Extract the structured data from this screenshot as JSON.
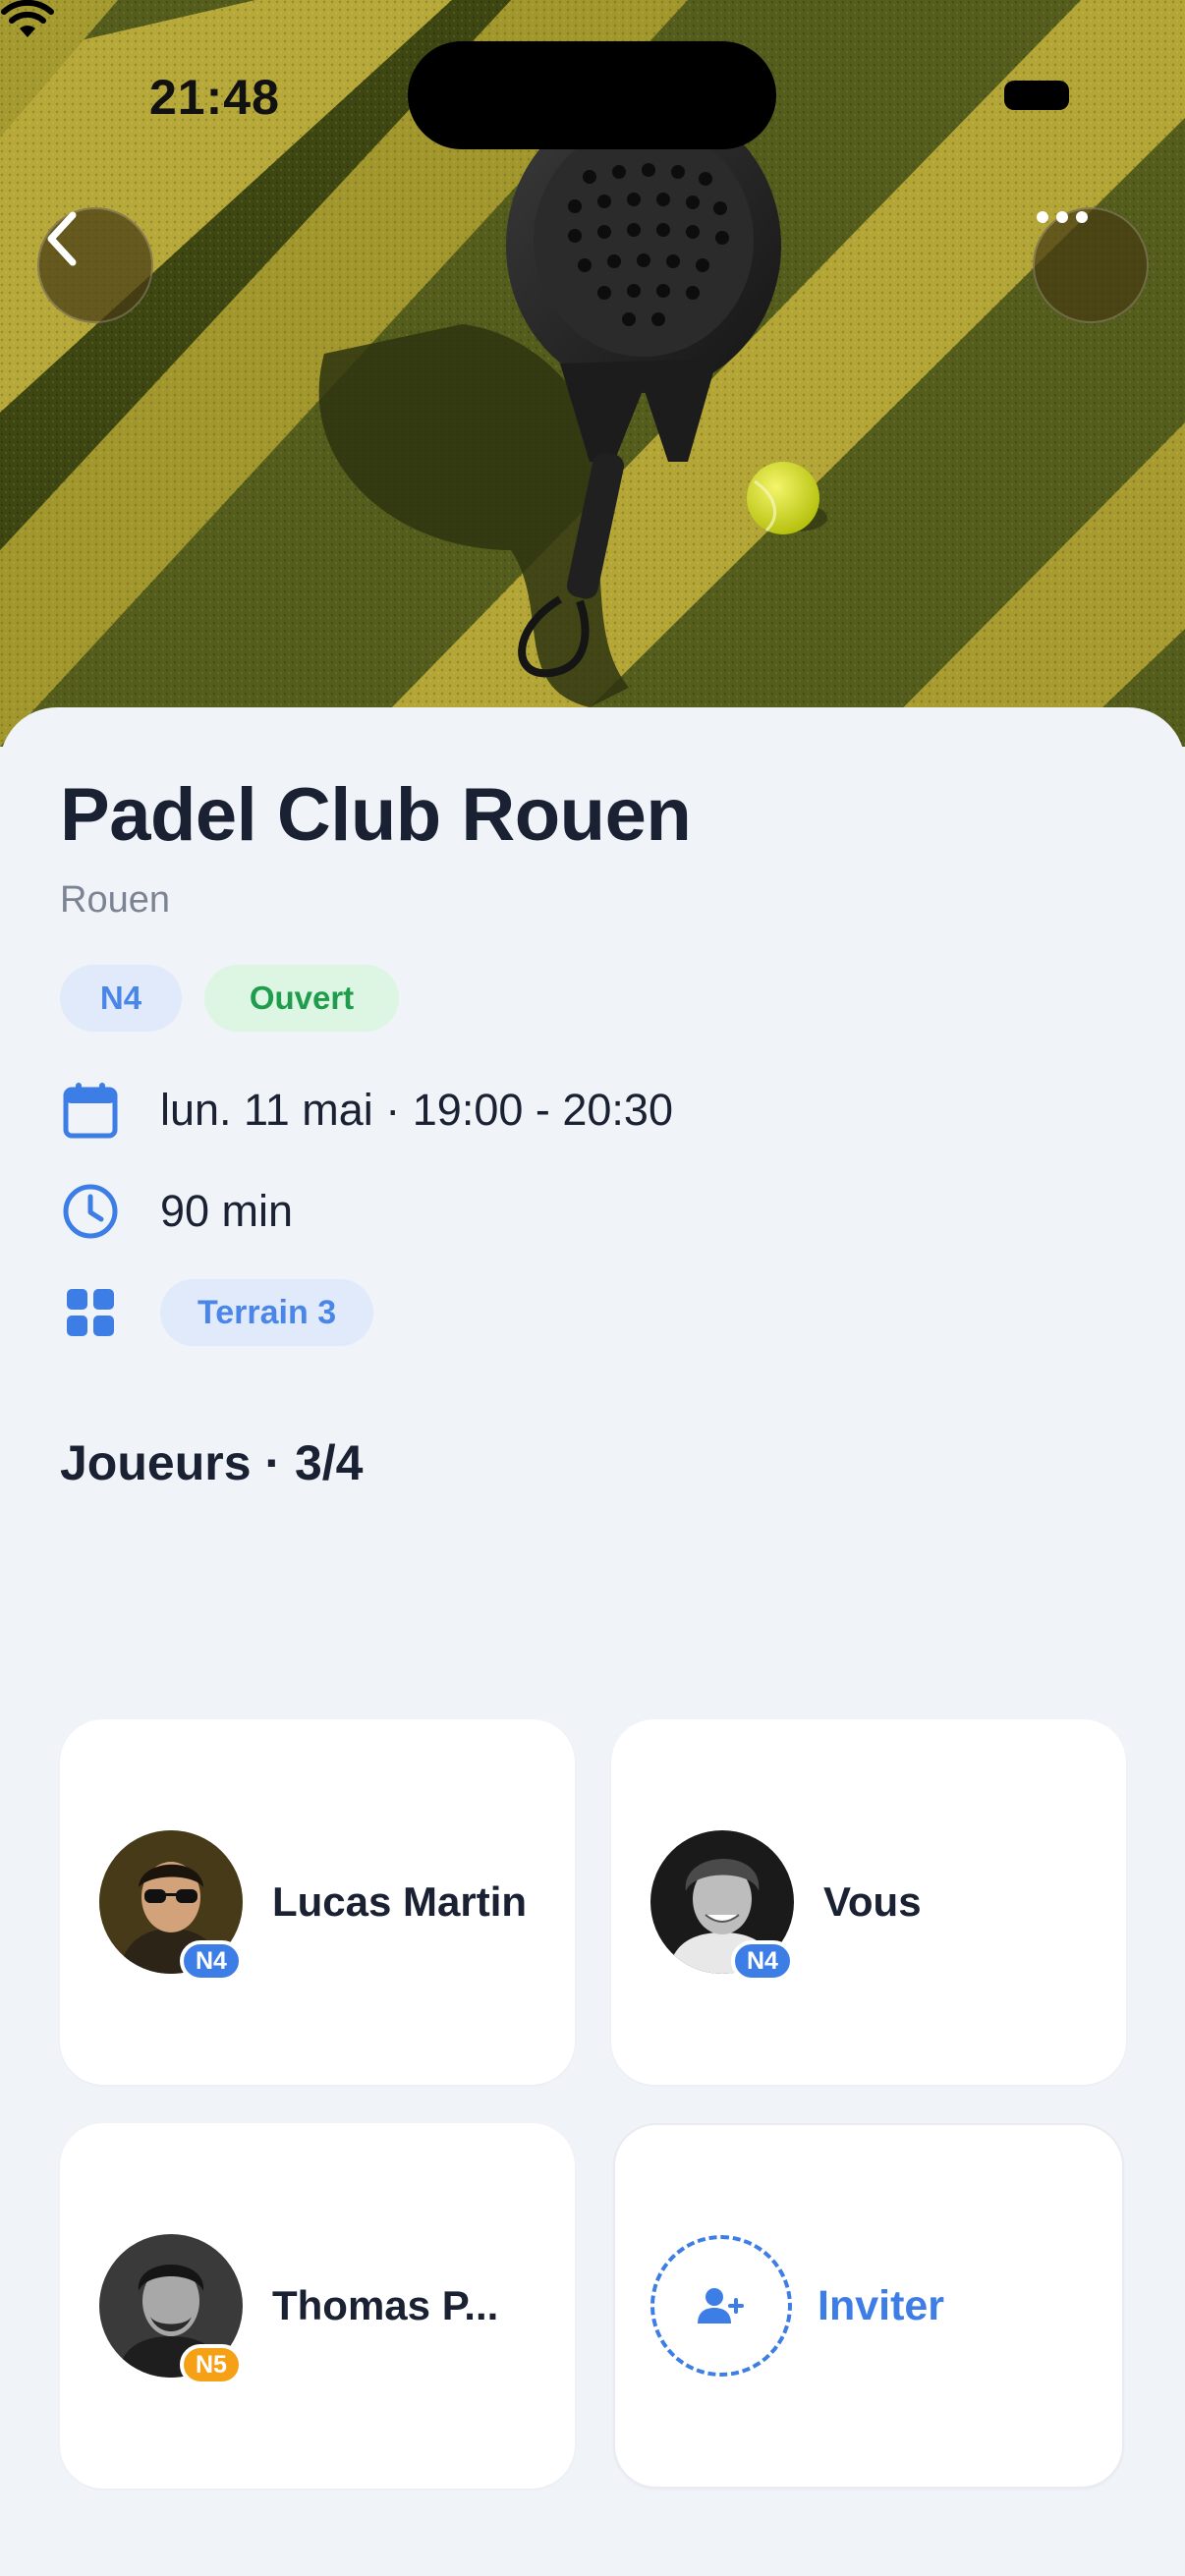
{
  "status_bar": {
    "time": "21:48"
  },
  "venue": {
    "name": "Padel Club Rouen",
    "city": "Rouen",
    "level_chip": "N4",
    "status_chip": "Ouvert"
  },
  "details": {
    "datetime": "lun. 11 mai · 19:00 - 20:30",
    "duration": "90 min",
    "court": "Terrain 3"
  },
  "players": {
    "heading": "Joueurs · 3/4",
    "list": [
      {
        "name": "Lucas Martin",
        "level": "N4"
      },
      {
        "name": "Vous",
        "level": "N4"
      },
      {
        "name": "Thomas P...",
        "level": "N5"
      }
    ],
    "invite_label": "Inviter"
  },
  "icons": {
    "back": "chevron-left-icon",
    "more": "ellipsis-icon",
    "date": "calendar-icon",
    "duration": "clock-icon",
    "court": "grid-icon",
    "invite": "add-user-icon"
  },
  "colors": {
    "accent": "#3d7ee6",
    "open_green": "#1f9d4d",
    "level_n5": "#f5a015",
    "text_primary": "#1a2133",
    "text_secondary": "#7c8494",
    "background": "#f0f3f8"
  }
}
